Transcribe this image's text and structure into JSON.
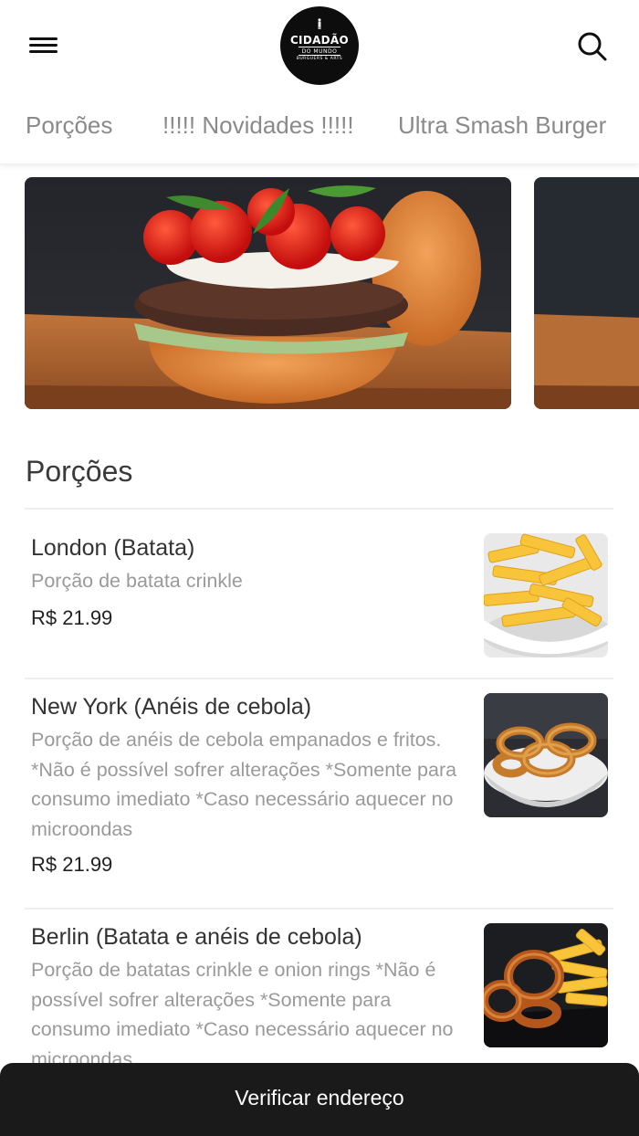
{
  "header": {
    "logo": {
      "name": "CIDADÃO",
      "subtitle": "DO MUNDO",
      "tagline": "BURGUERS & ARTS"
    },
    "icons": {
      "menu": "hamburger-menu-icon",
      "search": "search-icon"
    }
  },
  "tabs": [
    {
      "label": "Porções"
    },
    {
      "label": "!!!!! Novidades !!!!!"
    },
    {
      "label": "Ultra Smash Burger"
    }
  ],
  "section": {
    "title": "Porções",
    "items": [
      {
        "name": "London (Batata)",
        "description": "Porção de batata crinkle",
        "price": "R$ 21.99",
        "image": "crinkle-fries-photo"
      },
      {
        "name": "New York (Anéis de cebola)",
        "description": "Porção de anéis de cebola empanados e fritos. *Não é possível sofrer alterações *Somente para consumo imediato *Caso necessário aquecer no microondas",
        "price": "R$ 21.99",
        "image": "onion-rings-photo"
      },
      {
        "name": "Berlin (Batata e anéis de cebola)",
        "description": "Porção de batatas crinkle e onion rings *Não é possível sofrer alterações *Somente para consumo imediato *Caso necessário aquecer no microondas",
        "price": "",
        "image": "fries-and-onion-rings-photo"
      }
    ]
  },
  "bottom_bar": {
    "label": "Verificar endereço"
  },
  "colors": {
    "bar": "#1a1a1a",
    "tab_text": "#8a8a8a",
    "description": "#9a9a9a"
  }
}
